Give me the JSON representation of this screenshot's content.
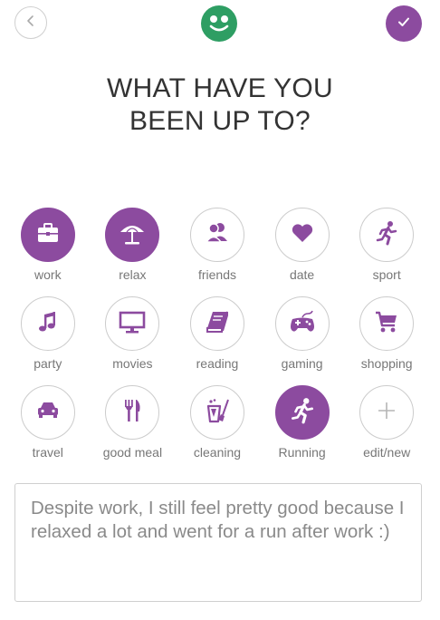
{
  "header": {
    "back_icon": "chevron-left-icon",
    "logo_icon": "smiley-face-icon",
    "confirm_icon": "check-icon",
    "accent_color": "#8c4b9f",
    "logo_color": "#2e9e63"
  },
  "title": {
    "line1": "WHAT HAVE YOU",
    "line2": "BEEN UP TO?"
  },
  "activities": [
    {
      "label": "work",
      "icon": "briefcase-icon",
      "selected": true
    },
    {
      "label": "relax",
      "icon": "beach-umbrella-icon",
      "selected": true
    },
    {
      "label": "friends",
      "icon": "people-icon",
      "selected": false
    },
    {
      "label": "date",
      "icon": "heart-icon",
      "selected": false
    },
    {
      "label": "sport",
      "icon": "runner-icon",
      "selected": false
    },
    {
      "label": "party",
      "icon": "music-note-icon",
      "selected": false
    },
    {
      "label": "movies",
      "icon": "tv-icon",
      "selected": false
    },
    {
      "label": "reading",
      "icon": "book-icon",
      "selected": false
    },
    {
      "label": "gaming",
      "icon": "gamepad-icon",
      "selected": false
    },
    {
      "label": "shopping",
      "icon": "cart-icon",
      "selected": false
    },
    {
      "label": "travel",
      "icon": "car-icon",
      "selected": false
    },
    {
      "label": "good meal",
      "icon": "fork-knife-icon",
      "selected": false
    },
    {
      "label": "cleaning",
      "icon": "cleaning-bucket-icon",
      "selected": false
    },
    {
      "label": "Running",
      "icon": "runner-icon",
      "selected": true
    },
    {
      "label": "edit/new",
      "icon": "plus-icon",
      "selected": false
    }
  ],
  "note": {
    "text": "Despite work, I still feel pretty good because I relaxed a lot and went for a run after work :)"
  }
}
